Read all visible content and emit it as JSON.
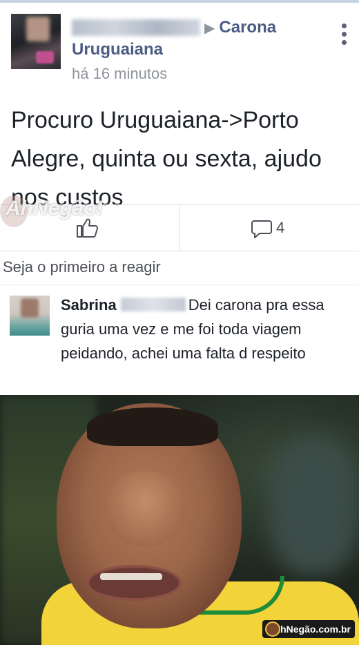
{
  "post": {
    "group_line1": "Carona",
    "group_line2": "Uruguaiana",
    "timestamp": "há 16 minutos",
    "text": "Procuro Uruguaiana->Porto Alegre, quinta ou sexta, ajudo nos custos"
  },
  "actions": {
    "comment_count": "4"
  },
  "reactions_text": "Seja o primeiro a reagir",
  "comment": {
    "author": "Sabrina",
    "text": "Dei carona pra essa guria uma vez e me foi toda viagem peidando, achei uma falta d respeito"
  },
  "watermark": "AhNegão!",
  "photo_logo": "AhNegão.com.br",
  "icons": [
    "overflow-menu-icon",
    "like-icon",
    "comment-icon"
  ],
  "colors": {
    "group_link": "#4b5c84",
    "meta_gray": "#90949c",
    "shirt_yellow": "#f3d33a",
    "collar_green": "#1f8a3a"
  }
}
